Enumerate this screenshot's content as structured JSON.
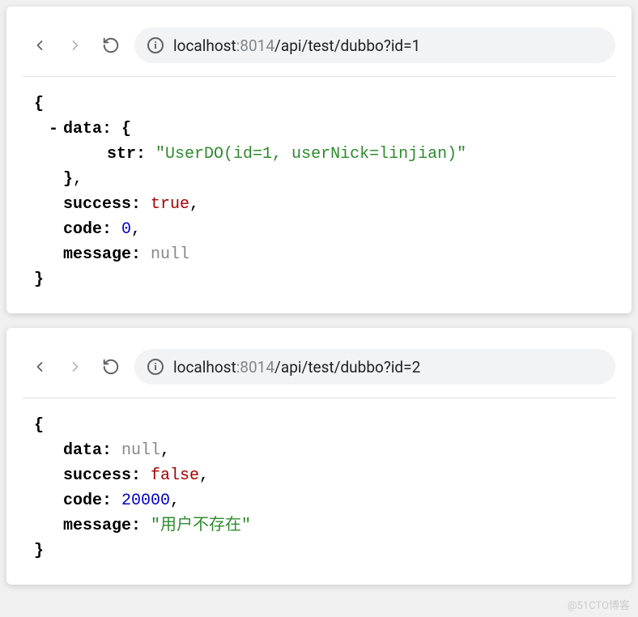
{
  "card1": {
    "url": {
      "host": "localhost",
      "port": ":8014",
      "path": "/api/test/dubbo?id=1"
    },
    "json": {
      "toggle": "-",
      "dataKey": "data:",
      "strKey": "str:",
      "strVal": "\"UserDO(id=1, userNick=linjian)\"",
      "successKey": "success:",
      "successVal": "true",
      "codeKey": "code:",
      "codeVal": "0",
      "messageKey": "message:",
      "messageVal": "null"
    }
  },
  "card2": {
    "url": {
      "host": "localhost",
      "port": ":8014",
      "path": "/api/test/dubbo?id=2"
    },
    "json": {
      "dataKey": "data:",
      "dataVal": "null",
      "successKey": "success:",
      "successVal": "false",
      "codeKey": "code:",
      "codeVal": "20000",
      "messageKey": "message:",
      "messageVal": "\"用户不存在\""
    }
  },
  "watermark": "@51CTO博客"
}
